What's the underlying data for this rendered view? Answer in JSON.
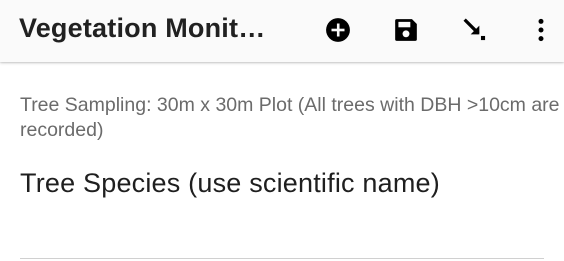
{
  "app_bar": {
    "title": "Vegetation Monit…",
    "actions": [
      {
        "icon": "add-circle-icon",
        "label": "Add repeat"
      },
      {
        "icon": "save-icon",
        "label": "Save"
      },
      {
        "icon": "jump-arrow-icon",
        "label": "Go to"
      },
      {
        "icon": "more-vert-icon",
        "label": "More options"
      }
    ]
  },
  "form": {
    "hint": "Tree Sampling: 30m x 30m Plot (All trees with DBH >10cm are recorded)",
    "question_label": "Tree Species (use scientific name)",
    "answer_value": ""
  },
  "colors": {
    "app_bar_background": "#fafafa",
    "icon": "#000000",
    "hint_text": "#6b6b6b",
    "label_text": "#1f1f1f"
  }
}
